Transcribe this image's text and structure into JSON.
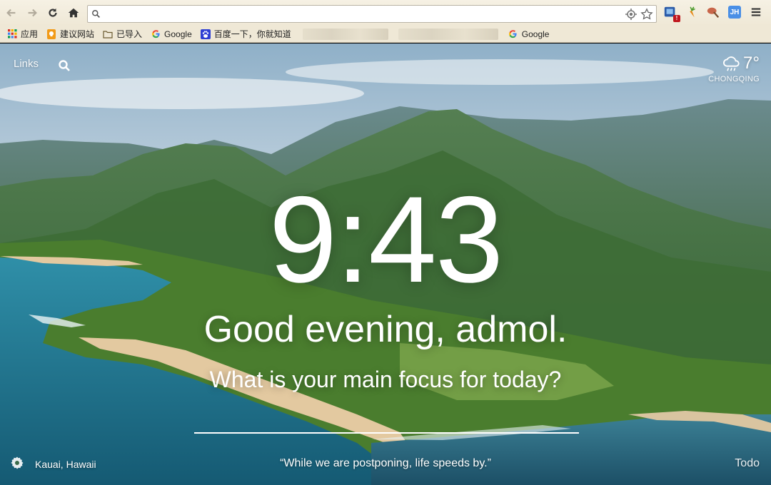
{
  "browser": {
    "omnibox": {
      "value": "",
      "placeholder": ""
    },
    "icons": [
      "back-arrow-icon",
      "forward-arrow-icon",
      "reload-icon",
      "home-icon",
      "search-icon",
      "location-target-icon",
      "bookmark-star-icon",
      "extension-icon",
      "carrot-extension-icon",
      "brush-extension-icon",
      "jh-extension-icon",
      "menu-icon"
    ],
    "extension_badge": "!",
    "jh_label": "JH",
    "bookmarks": [
      {
        "label": "应用",
        "icon": "apps-grid-icon"
      },
      {
        "label": "建议网站",
        "icon": "suggested-sites-icon"
      },
      {
        "label": "已导入",
        "icon": "folder-icon"
      },
      {
        "label": "Google",
        "icon": "google-icon"
      },
      {
        "label": "百度一下，你就知道",
        "icon": "baidu-icon"
      },
      {
        "label": "Google",
        "icon": "google-icon"
      }
    ]
  },
  "page": {
    "links_label": "Links",
    "weather": {
      "temp": "7°",
      "city": "CHONGQING",
      "icon": "cloud-rain-icon"
    },
    "clock": "9:43",
    "greeting": "Good evening, admol.",
    "focus_question": "What is your main focus for today?",
    "focus_input": {
      "value": "",
      "placeholder": ""
    },
    "location": "Kauai, Hawaii",
    "quote": "“While we are postponing, life speeds by.”",
    "todo_label": "Todo"
  },
  "colors": {
    "chrome_bg": "#efe8d6",
    "text_on_photo": "#ffffff"
  }
}
